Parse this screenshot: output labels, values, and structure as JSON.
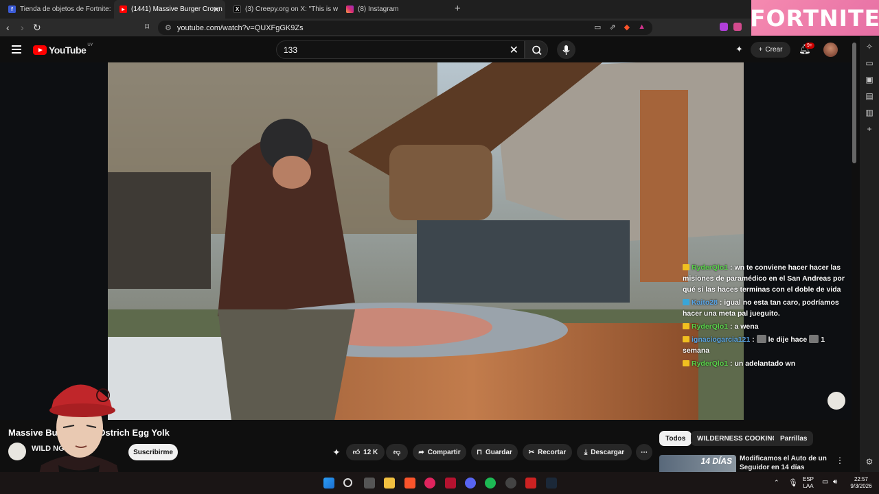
{
  "browser": {
    "tabs": [
      {
        "label": "Tienda de objetos de Fortnite: Conte",
        "icon": "fortnite-tab-icon"
      },
      {
        "label": "(1441) Massive Burger Crown",
        "icon": "youtube-tab-icon"
      },
      {
        "label": "(3) Creepy.org on X: \"This is why two",
        "icon": "x-tab-icon"
      },
      {
        "label": "(8) Instagram",
        "icon": "instagram-tab-icon"
      }
    ],
    "url": "youtube.com/watch?v=QUXFgGK9Zs"
  },
  "banner": {
    "text": "FORTNITE"
  },
  "youtube": {
    "logo_text": "YouTube",
    "region": "UY",
    "search_value": "133",
    "create_label": "Crear",
    "notif_count": "9+"
  },
  "chat": [
    {
      "user": "RyderQlo1",
      "color": "green",
      "text": ": wn te conviene hacer hacer las misiones de paramédico en el San Andreas por qué si las haces terminas con el doble de vida"
    },
    {
      "user": "Kaito28",
      "color": "blue",
      "text": ": igual no esta tan caro, podríamos hacer una meta pal jueguito."
    },
    {
      "user": "RyderQlo1",
      "color": "green",
      "text": ": a wena"
    },
    {
      "user": "ignaciogarcia121",
      "color": "blue",
      "text": ":",
      "text2": "le dije hace",
      "text3": "1 semana"
    },
    {
      "user": "RyderQlo1",
      "color": "green",
      "text": ": un adelantado wn"
    }
  ],
  "video": {
    "title": "Massive Burg        d With Ostrich Egg Yolk",
    "channel": "WILD          NG",
    "subscribe_label": "Suscribirme",
    "likes": "12 K",
    "share_label": "Compartir",
    "save_label": "Guardar",
    "clip_label": "Recortar",
    "download_label": "Descargar"
  },
  "chips": [
    "Todos",
    "WILDERNESS COOKING",
    "Parrillas"
  ],
  "recommendation": {
    "title": "Modificamos el Auto de un Seguidor en 14 días",
    "thumb_text": "14 DÍAS"
  },
  "taskbar": {
    "lang_top": "ESP",
    "lang_bottom": "LAA",
    "time": "22:57",
    "date": "9/3/2026"
  },
  "colors": {
    "accent_red": "#ff0000",
    "chat_green": "#59d34a",
    "chat_blue": "#5aa6e8",
    "banner_pink": "#f58ab0"
  }
}
